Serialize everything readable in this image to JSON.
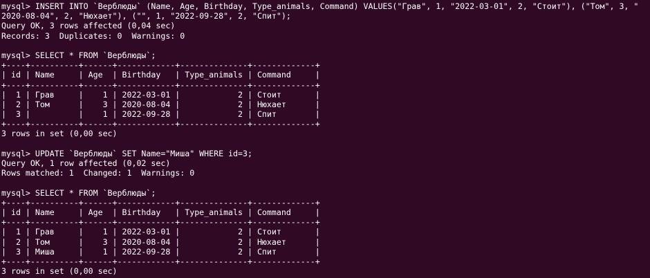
{
  "terminal": {
    "lines": [
      "mysql> INSERT INTO `Верблюды` (Name, Age, Birthday, Type_animals, Command) VALUES(\"Грав\", 1, \"2022-03-01\", 2, \"Стоит\"), (\"Том\", 3, \"",
      "2020-08-04\", 2, \"Нюхает\"), (\"\", 1, \"2022-09-28\", 2, \"Спит\");",
      "Query OK, 3 rows affected (0,04 sec)",
      "Records: 3  Duplicates: 0  Warnings: 0",
      "",
      "mysql> SELECT * FROM `Верблюды`;",
      "+----+----------+------+------------+--------------+-------------+",
      "| id | Name     | Age  | Birthday   | Type_animals | Command     |",
      "+----+----------+------+------------+--------------+-------------+",
      "|  1 | Грав     |    1 | 2022-03-01 |            2 | Стоит       |",
      "|  2 | Том      |    3 | 2020-08-04 |            2 | Нюхает      |",
      "|  3 |          |    1 | 2022-09-28 |            2 | Спит        |",
      "+----+----------+------+------------+--------------+-------------+",
      "3 rows in set (0,00 sec)",
      "",
      "mysql> UPDATE `Верблюды` SET Name=\"Миша\" WHERE id=3;",
      "Query OK, 1 row affected (0,02 sec)",
      "Rows matched: 1  Changed: 1  Warnings: 0",
      "",
      "mysql> SELECT * FROM `Верблюды`;",
      "+----+----------+------+------------+--------------+-------------+",
      "| id | Name     | Age  | Birthday   | Type_animals | Command     |",
      "+----+----------+------+------------+--------------+-------------+",
      "|  1 | Грав     |    1 | 2022-03-01 |            2 | Стоит       |",
      "|  2 | Том      |    3 | 2020-08-04 |            2 | Нюхает      |",
      "|  3 | Миша     |    1 | 2022-09-28 |            2 | Спит        |",
      "+----+----------+------+------------+--------------+-------------+",
      "3 rows in set (0,00 sec)"
    ]
  },
  "colors": {
    "background": "#300a24",
    "text": "#ffffff"
  }
}
